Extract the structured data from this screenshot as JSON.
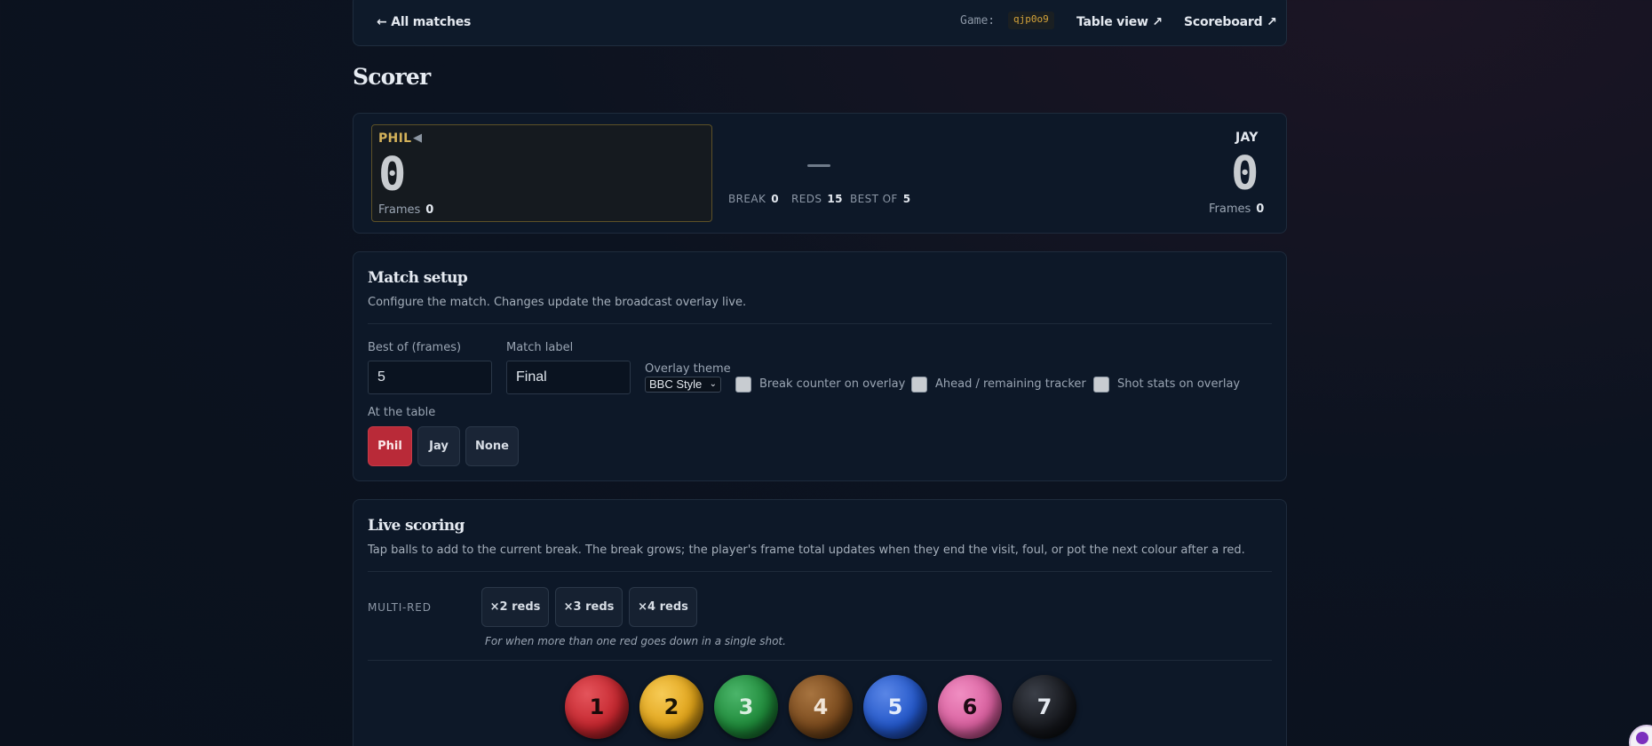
{
  "nav": {
    "back": "← All matches",
    "game_label": "Game:",
    "game_code": "qjp0o9",
    "table_view": "Table view ↗",
    "scoreboard": "Scoreboard ↗"
  },
  "page_title": "Scorer",
  "score": {
    "player1": {
      "name": "PHIL",
      "turn_marker": "◀",
      "score": "0",
      "frames_label": "Frames",
      "frames": "0"
    },
    "player2": {
      "name": "JAY",
      "score": "0",
      "frames_label": "Frames",
      "frames": "0"
    },
    "center": "—",
    "break_label": "BREAK",
    "break_value": "0",
    "reds_label": "REDS",
    "reds_value": "15",
    "bestof_label": "BEST OF",
    "bestof_value": "5"
  },
  "setup": {
    "title": "Match setup",
    "description": "Configure the match. Changes update the broadcast overlay live.",
    "best_of_label": "Best of (frames)",
    "best_of_value": "5",
    "match_label_label": "Match label",
    "match_label_value": "Final",
    "overlay_theme_label": "Overlay theme",
    "overlay_theme_value": "BBC Style",
    "checkboxes": [
      {
        "label": "Break counter on overlay",
        "checked": false
      },
      {
        "label": "Ahead / remaining tracker",
        "checked": false
      },
      {
        "label": "Shot stats on overlay",
        "checked": false
      }
    ],
    "at_table_label": "At the table",
    "at_table_options": [
      "Phil",
      "Jay",
      "None"
    ],
    "at_table_selected": "Phil"
  },
  "scoring": {
    "title": "Live scoring",
    "description": "Tap balls to add to the current break. The break grows; the player's frame total updates when they end the visit, foul, or pot the next colour after a red.",
    "multi_red_label": "MULTI-RED",
    "multi_red_buttons": [
      "×2 reds",
      "×3 reds",
      "×4 reds"
    ],
    "multi_red_hint": "For when more than one red goes down in a single shot.",
    "balls": [
      {
        "value": "1",
        "color": "#c4262e"
      },
      {
        "value": "2",
        "color": "#e0a319"
      },
      {
        "value": "3",
        "color": "#1f8a3a"
      },
      {
        "value": "4",
        "color": "#7a4a1d"
      },
      {
        "value": "5",
        "color": "#2357c9"
      },
      {
        "value": "6",
        "color": "#d9609f"
      },
      {
        "value": "7",
        "color": "#15171c"
      }
    ]
  },
  "colors": {
    "accent_gold": "#d4b25a",
    "active_red": "#b92a38"
  }
}
